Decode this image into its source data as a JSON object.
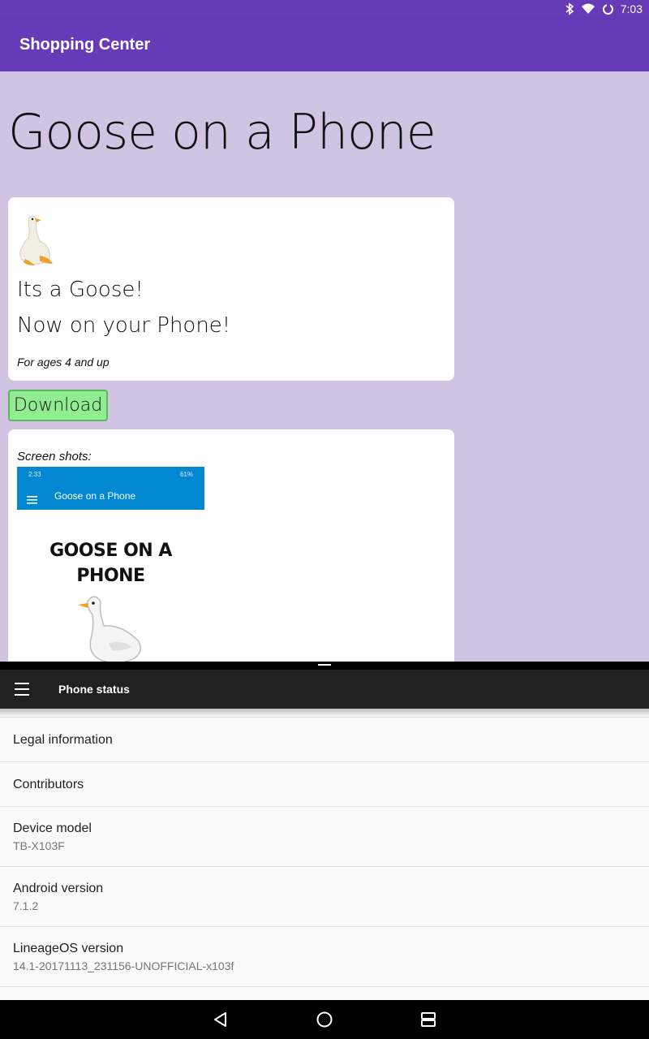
{
  "status_bar": {
    "time": "7:03",
    "icons": [
      "bluetooth-icon",
      "wifi-icon",
      "sync-icon"
    ]
  },
  "app_bar": {
    "title": "Shopping Center"
  },
  "web_page": {
    "heading": "Goose on a Phone",
    "card": {
      "tagline1": "Its a Goose!",
      "tagline2": "Now on your Phone!",
      "ages": "For ages 4 and up"
    },
    "download_label": "Download",
    "screenshots": {
      "label": "Screen shots:",
      "shot_time": "2:33",
      "shot_battery": "61%",
      "shot_app_title": "Goose on a Phone",
      "shot_headline": "GOOSE ON A PHONE"
    }
  },
  "settings": {
    "title": "Phone status",
    "rows": [
      {
        "title": "Legal information"
      },
      {
        "title": "Contributors"
      },
      {
        "title": "Device model",
        "subtitle": "TB-X103F"
      },
      {
        "title": "Android version",
        "subtitle": "7.1.2"
      },
      {
        "title": "LineageOS version",
        "subtitle": "14.1-20171113_231156-UNOFFICIAL-x103f"
      }
    ]
  },
  "colors": {
    "app_bar": "#673ab7",
    "web_background": "#d1c4e3",
    "download_button": "#90ee90",
    "screenshot_bar": "#0288d1",
    "settings_toolbar": "#212121"
  }
}
